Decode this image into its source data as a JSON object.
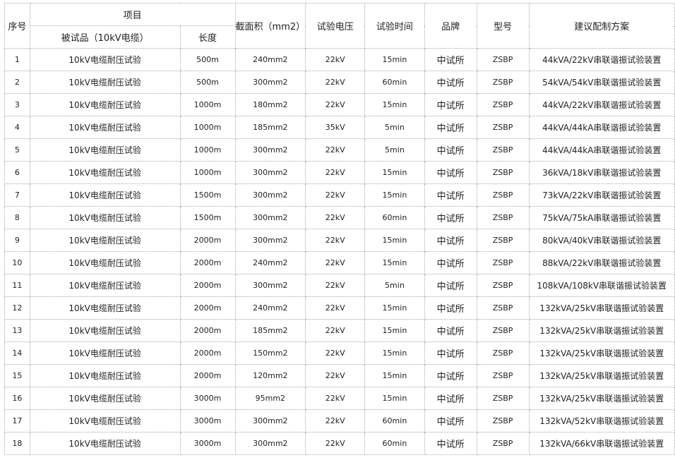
{
  "headers": {
    "seq": "序号",
    "project": "项目",
    "tested": "被试品（10kV电缆）",
    "length": "长度",
    "section": "截面积（mm2）",
    "voltage": "试验电压",
    "time": "试验时间",
    "brand": "品牌",
    "model": "型号",
    "plan": "建议配制方案"
  },
  "rows": [
    {
      "seq": "1",
      "item": "10kV电缆耐压试验",
      "length": "500m",
      "section": "240mm2",
      "voltage": "22kV",
      "time": "15min",
      "brand": "中试所",
      "model": "ZSBP",
      "plan": "44kVA/22kV串联谐振试验装置"
    },
    {
      "seq": "2",
      "item": "10kV电缆耐压试验",
      "length": "500m",
      "section": "300mm2",
      "voltage": "22kV",
      "time": "60min",
      "brand": "中试所",
      "model": "ZSBP",
      "plan": "54kVA/54kV串联谐振试验装置"
    },
    {
      "seq": "3",
      "item": "10kV电缆耐压试验",
      "length": "1000m",
      "section": "180mm2",
      "voltage": "22kV",
      "time": "15min",
      "brand": "中试所",
      "model": "ZSBP",
      "plan": "44kVA/22kV串联谐振试验装置"
    },
    {
      "seq": "4",
      "item": "10kV电缆耐压试验",
      "length": "1000m",
      "section": "185mm2",
      "voltage": "35kV",
      "time": "5min",
      "brand": "中试所",
      "model": "ZSBP",
      "plan": "44kVA/44kA串联谐振试验装置"
    },
    {
      "seq": "5",
      "item": "10kV电缆耐压试验",
      "length": "1000m",
      "section": "300mm2",
      "voltage": "22kV",
      "time": "5min",
      "brand": "中试所",
      "model": "ZSBP",
      "plan": "44kVA/44kA串联谐振试验装置"
    },
    {
      "seq": "6",
      "item": "10kV电缆耐压试验",
      "length": "1000m",
      "section": "300mm2",
      "voltage": "22kV",
      "time": "15min",
      "brand": "中试所",
      "model": "ZSBP",
      "plan": "36kVA/18kV串联谐振试验装置"
    },
    {
      "seq": "7",
      "item": "10kV电缆耐压试验",
      "length": "1500m",
      "section": "300mm2",
      "voltage": "22kV",
      "time": "15min",
      "brand": "中试所",
      "model": "ZSBP",
      "plan": "73kVA/22kV串联谐振试验装置"
    },
    {
      "seq": "8",
      "item": "10kV电缆耐压试验",
      "length": "1500m",
      "section": "300mm2",
      "voltage": "22kV",
      "time": "60min",
      "brand": "中试所",
      "model": "ZSBP",
      "plan": "75kVA/75kA串联谐振试验装置"
    },
    {
      "seq": "9",
      "item": "10kV电缆耐压试验",
      "length": "2000m",
      "section": "300mm2",
      "voltage": "22kV",
      "time": "15min",
      "brand": "中试所",
      "model": "ZSBP",
      "plan": "80kVA/40kV串联谐振试验装置"
    },
    {
      "seq": "10",
      "item": "10kV电缆耐压试验",
      "length": "2000m",
      "section": "240mm2",
      "voltage": "22kV",
      "time": "15min",
      "brand": "中试所",
      "model": "ZSBP",
      "plan": "88kVA/22kV串联谐振试验装置"
    },
    {
      "seq": "11",
      "item": "10kV电缆耐压试验",
      "length": "2000m",
      "section": "300mm2",
      "voltage": "22kV",
      "time": "5min",
      "brand": "中试所",
      "model": "ZSBP",
      "plan": "108kVA/108kV串联谐振试验装置"
    },
    {
      "seq": "12",
      "item": "10kV电缆耐压试验",
      "length": "2000m",
      "section": "240mm2",
      "voltage": "22kV",
      "time": "15min",
      "brand": "中试所",
      "model": "ZSBP",
      "plan": "132kVA/25kV串联谐振试验装置"
    },
    {
      "seq": "13",
      "item": "10kV电缆耐压试验",
      "length": "2000m",
      "section": "185mm2",
      "voltage": "22kV",
      "time": "15min",
      "brand": "中试所",
      "model": "ZSBP",
      "plan": "132kVA/25kV串联谐振试验装置"
    },
    {
      "seq": "14",
      "item": "10kV电缆耐压试验",
      "length": "2000m",
      "section": "150mm2",
      "voltage": "22kV",
      "time": "15min",
      "brand": "中试所",
      "model": "ZSBP",
      "plan": "132kVA/25kV串联谐振试验装置"
    },
    {
      "seq": "15",
      "item": "10kV电缆耐压试验",
      "length": "2000m",
      "section": "120mm2",
      "voltage": "22kV",
      "time": "15min",
      "brand": "中试所",
      "model": "ZSBP",
      "plan": "132kVA/25kV串联谐振试验装置"
    },
    {
      "seq": "16",
      "item": "10kV电缆耐压试验",
      "length": "3000m",
      "section": "95mm2",
      "voltage": "22kV",
      "time": "15min",
      "brand": "中试所",
      "model": "ZSBP",
      "plan": "132kVA/25kV串联谐振试验装置"
    },
    {
      "seq": "17",
      "item": "10kV电缆耐压试验",
      "length": "3000m",
      "section": "300mm2",
      "voltage": "22kV",
      "time": "60min",
      "brand": "中试所",
      "model": "ZSBP",
      "plan": "132kVA/52kV串联谐振试验装置"
    },
    {
      "seq": "18",
      "item": "10kV电缆耐压试验",
      "length": "3000m",
      "section": "300mm2",
      "voltage": "22kV",
      "time": "60min",
      "brand": "中试所",
      "model": "ZSBP",
      "plan": "132kVA/66kV串联谐振试验装置"
    }
  ]
}
